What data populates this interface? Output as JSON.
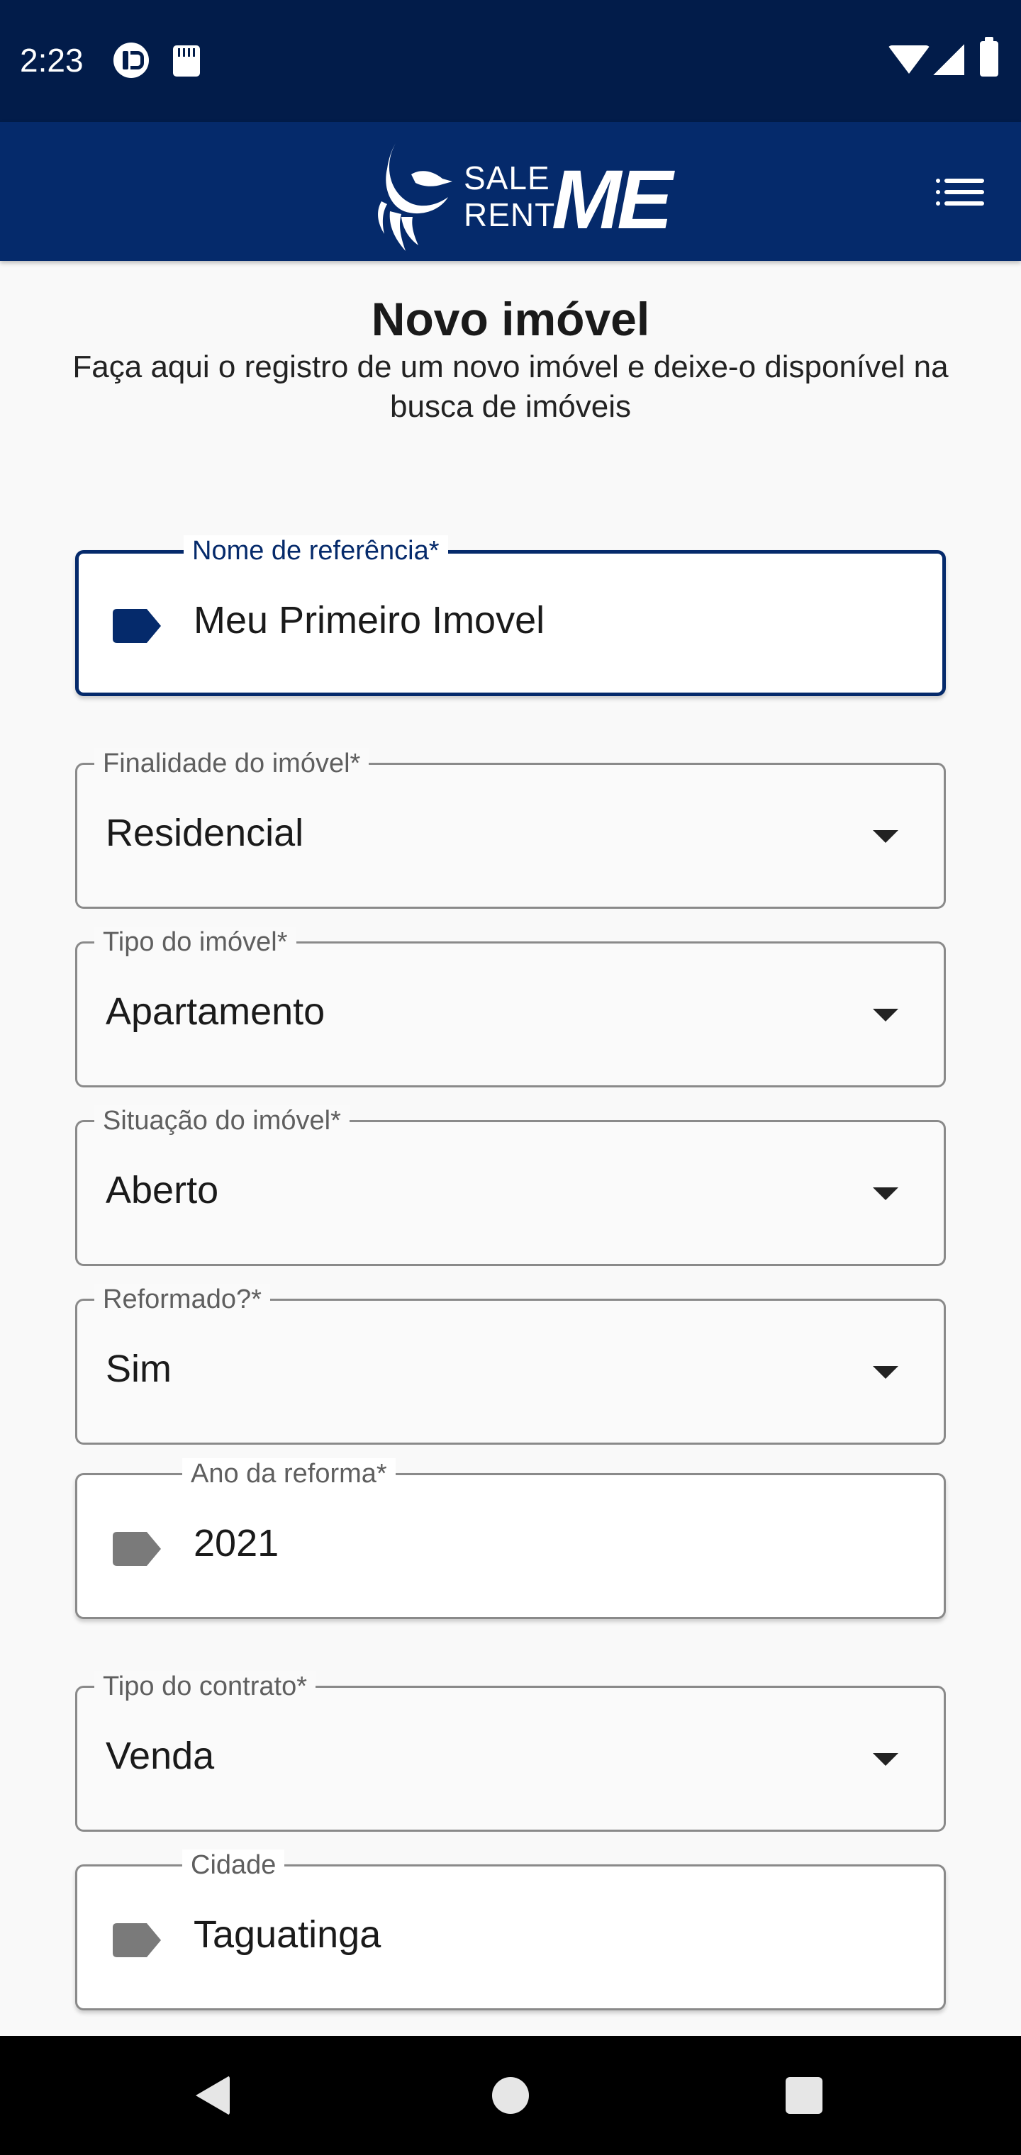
{
  "status_bar": {
    "time": "2:23",
    "icons": [
      "app-notification-icon",
      "sd-card-icon",
      "wifi-icon",
      "cell-signal-icon",
      "battery-icon"
    ]
  },
  "header": {
    "logo": {
      "sale": "SALE",
      "rent": "RENT",
      "me": "ME"
    },
    "menu_icon": "menu-icon"
  },
  "page": {
    "title": "Novo imóvel",
    "subtitle": "Faça aqui o registro de um novo imóvel e deixe-o disponível na busca de imóveis"
  },
  "form": {
    "reference_name": {
      "label": "Nome de referência*",
      "value": "Meu Primeiro Imovel"
    },
    "purpose": {
      "label": "Finalidade do imóvel*",
      "value": "Residencial"
    },
    "property_type": {
      "label": "Tipo do imóvel*",
      "value": "Apartamento"
    },
    "situation": {
      "label": "Situação do imóvel*",
      "value": "Aberto"
    },
    "renovated": {
      "label": "Reformado?*",
      "value": "Sim"
    },
    "renovation_year": {
      "label": "Ano da reforma*",
      "value": "2021"
    },
    "contract_type": {
      "label": "Tipo do contrato*",
      "value": "Venda"
    },
    "city": {
      "label": "Cidade",
      "value": "Taguatinga"
    }
  },
  "colors": {
    "status_bar": "#021c4a",
    "app_bar": "#052a6b",
    "focused_accent": "#052a6b",
    "inactive_icon": "#7a7a7a",
    "background": "#f9f9f9"
  },
  "nav_bar": {
    "icons": [
      "back-icon",
      "home-icon",
      "recents-icon"
    ]
  }
}
